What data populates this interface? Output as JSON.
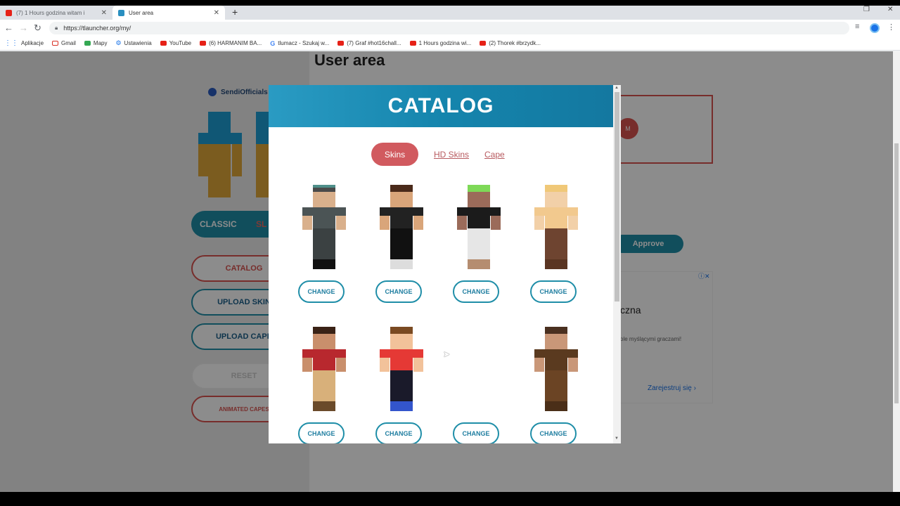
{
  "browser": {
    "tabs": [
      {
        "title": "(7) 1 Hours godzina witam i",
        "active": false
      },
      {
        "title": "User area",
        "active": true
      }
    ],
    "url": "https://tlauncher.org/my/",
    "bookmarks": [
      {
        "label": "Aplikacje",
        "icon": "apps-icon"
      },
      {
        "label": "Gmail",
        "icon": "gmail-icon"
      },
      {
        "label": "Mapy",
        "icon": "maps-icon"
      },
      {
        "label": "Ustawienia",
        "icon": "settings-icon"
      },
      {
        "label": "YouTube",
        "icon": "youtube-icon"
      },
      {
        "label": "(6) HARMANIM BA...",
        "icon": "youtube-icon"
      },
      {
        "label": "tlumacz - Szukaj w...",
        "icon": "google-icon"
      },
      {
        "label": "(7) Graf #hot16chall...",
        "icon": "youtube-icon"
      },
      {
        "label": "1 Hours godzina wi...",
        "icon": "youtube-icon"
      },
      {
        "label": "(2) Thorek #brzydk...",
        "icon": "youtube-icon"
      }
    ]
  },
  "page": {
    "title": "User area",
    "username": "SendiOfficials",
    "model_toggle": {
      "classic": "CLASSIC",
      "slim": "SL"
    },
    "buttons": {
      "catalog": "CATALOG",
      "upload_skin": "UPLOAD SKIN",
      "upload_cape": "UPLOAD CAPE",
      "reset": "RESET",
      "animated_capes": "ANIMATED CAPES"
    },
    "premium_badge": "M",
    "approve": "Approve",
    "ad": {
      "title": "czna",
      "subtitle": "ole myślącymi graczami!",
      "link": "Zarejestruj się  ›"
    }
  },
  "modal": {
    "title": "CATALOG",
    "tabs": [
      {
        "label": "Skins",
        "active": true
      },
      {
        "label": "HD Skins",
        "active": false
      },
      {
        "label": "Cape",
        "active": false
      }
    ],
    "change_label": "CHANGE",
    "skins": [
      {
        "id": 1,
        "hair": "#4a4a4a",
        "hat": "#4f8f8a",
        "face": "#d9b08c",
        "shirt": "#4b5455",
        "pants": "#3b4142",
        "shoes": "#111"
      },
      {
        "id": 2,
        "hair": "#4a2a1a",
        "hat": "#4a2a1a",
        "face": "#d9a57a",
        "shirt": "#222222",
        "pants": "#111111",
        "shoes": "#ddd"
      },
      {
        "id": 3,
        "hair": "#7ed957",
        "hat": "#7ed957",
        "face": "#9b6b5a",
        "shirt": "#1b1b1b",
        "pants": "#e6e6e6",
        "shoes": "#b58d70"
      },
      {
        "id": 4,
        "hair": "#f0c878",
        "hat": "#f0c878",
        "face": "#f2d0a8",
        "shirt": "#f2c98e",
        "pants": "#6e4430",
        "shoes": "#5a3522"
      },
      {
        "id": 5,
        "hair": "#3a2216",
        "hat": "#3a2216",
        "face": "#c98f6c",
        "shirt": "#b8282e",
        "pants": "#d8b07a",
        "shoes": "#6a4a2a"
      },
      {
        "id": 6,
        "hair": "#7a4a22",
        "hat": "#7a4a22",
        "face": "#f2c29a",
        "shirt": "#e53935",
        "pants": "#1a1a2a",
        "shoes": "#3355cc"
      },
      {
        "id": 7,
        "hair": null,
        "hat": null,
        "face": null,
        "shirt": null,
        "pants": null,
        "shoes": null
      },
      {
        "id": 8,
        "hair": "#4a3020",
        "hat": "#4a3020",
        "face": "#c99778",
        "shirt": "#5a3a1f",
        "pants": "#6b4424",
        "shoes": "#4a2e18"
      }
    ]
  },
  "colors": {
    "accent": "#1f8ea8",
    "danger": "#d15a5f"
  }
}
